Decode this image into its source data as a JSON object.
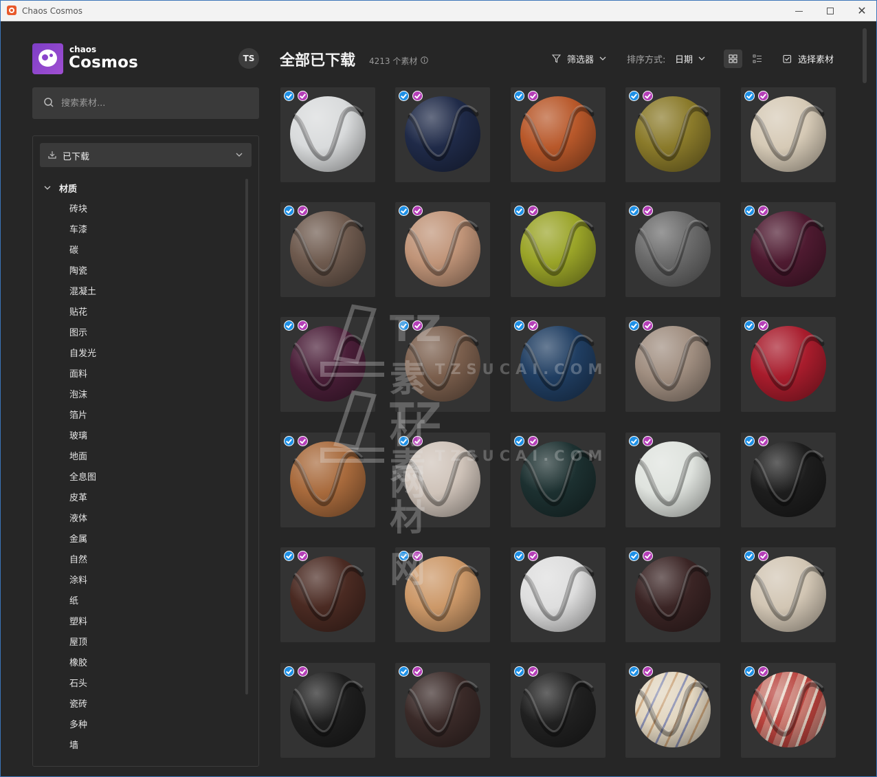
{
  "window": {
    "title": "Chaos Cosmos"
  },
  "brand": {
    "line1": "chaos",
    "line2": "Cosmos"
  },
  "user": {
    "initials": "TS"
  },
  "search": {
    "placeholder": "搜索素材..."
  },
  "sidebar": {
    "source_dropdown": "已下载",
    "category_title": "材质",
    "categories": [
      "砖块",
      "车漆",
      "碳",
      "陶瓷",
      "混凝土",
      "贴花",
      "图示",
      "自发光",
      "面料",
      "泡沫",
      "箔片",
      "玻璃",
      "地面",
      "全息图",
      "皮革",
      "液体",
      "金属",
      "自然",
      "涂料",
      "纸",
      "塑料",
      "屋顶",
      "橡胶",
      "石头",
      "瓷砖",
      "多种",
      "墙"
    ]
  },
  "header": {
    "title": "全部已下载",
    "count": "4213 个素材",
    "filter_label": "筛选器",
    "sort_label": "排序方式:",
    "sort_value": "日期",
    "select_label": "选择素材"
  },
  "colors": {
    "accent_check": "#1e90e6",
    "accent_vray": "#b53fb8"
  },
  "materials": [
    {
      "color": "#d9dbdc"
    },
    {
      "color": "#1f2a48"
    },
    {
      "color": "#b8582a"
    },
    {
      "color": "#8a7a2a"
    },
    {
      "color": "#d6cab6"
    },
    {
      "color": "#6e5a4e"
    },
    {
      "color": "#c09478"
    },
    {
      "color": "#9aa428"
    },
    {
      "color": "#6a6a6a"
    },
    {
      "color": "#4e1a30"
    },
    {
      "color": "#4a1e38"
    },
    {
      "color": "#7a5e4c"
    },
    {
      "color": "#203e62"
    },
    {
      "color": "#a08e80"
    },
    {
      "color": "#a81c2c"
    },
    {
      "color": "#a86a3c"
    },
    {
      "color": "#cfc3b9"
    },
    {
      "color": "#1c3030"
    },
    {
      "color": "#dfe3de"
    },
    {
      "color": "#1d1d1d"
    },
    {
      "color": "#4a2a22"
    },
    {
      "color": "#cc9868"
    },
    {
      "color": "#dedede"
    },
    {
      "color": "#3a2424"
    },
    {
      "color": "#d2c6b4"
    },
    {
      "color": "#1e1e1e"
    },
    {
      "color": "#3a2a28"
    },
    {
      "color": "#202020"
    },
    {
      "color": "#e2d6c0",
      "pattern": "stripes-blue"
    },
    {
      "color": "#c87a70",
      "pattern": "stripes-red"
    }
  ],
  "watermark": {
    "brand": "TZ素材网",
    "url": "TZSUCAI.COM"
  }
}
